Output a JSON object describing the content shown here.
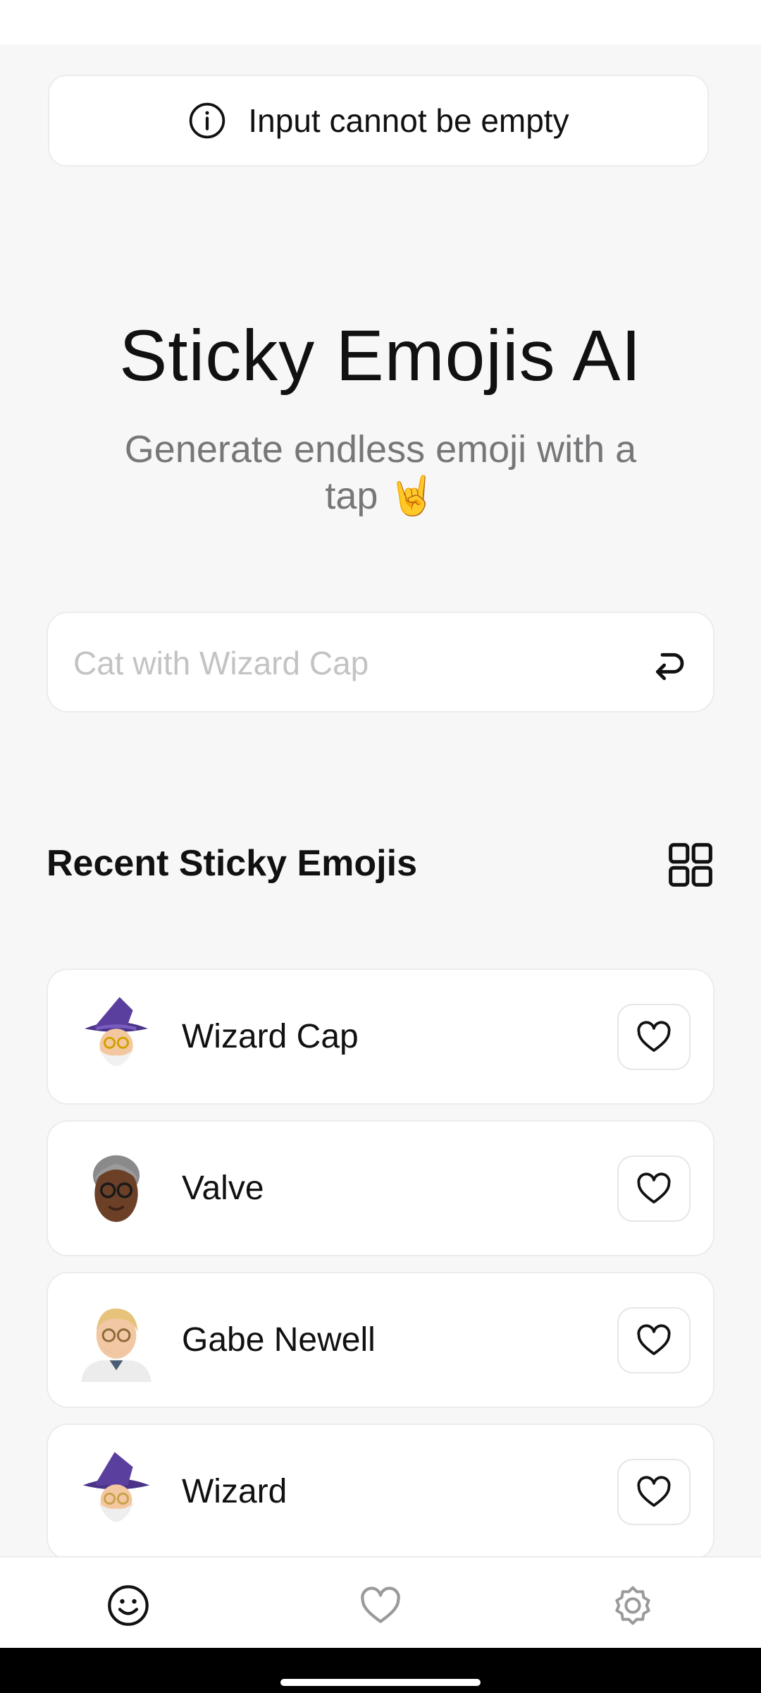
{
  "toast": {
    "message": "Input cannot be empty",
    "icon": "info-icon"
  },
  "header": {
    "title": "Sticky Emojis AI",
    "subtitle": "Generate endless emoji with a tap 🤘"
  },
  "prompt": {
    "placeholder": "Cat with Wizard Cap",
    "value": "",
    "submit_icon": "enter-icon"
  },
  "recent": {
    "title": "Recent Sticky Emojis",
    "view_toggle_icon": "grid-view-icon",
    "items": [
      {
        "label": "Wizard Cap",
        "avatar": "wizard-old-man-emoji",
        "favorited": false
      },
      {
        "label": "Valve",
        "avatar": "man-with-glasses-emoji",
        "favorited": false
      },
      {
        "label": "Gabe Newell",
        "avatar": "blond-man-with-glasses-emoji",
        "favorited": false
      },
      {
        "label": "Wizard",
        "avatar": "wizard-emoji",
        "favorited": false
      }
    ]
  },
  "bottom_nav": {
    "items": [
      {
        "name": "home",
        "icon": "smiley-icon",
        "active": true
      },
      {
        "name": "favorites",
        "icon": "heart-icon",
        "active": false
      },
      {
        "name": "settings",
        "icon": "gear-icon",
        "active": false
      }
    ]
  },
  "colors": {
    "background": "#f7f7f8",
    "card": "#ffffff",
    "border": "#ececee",
    "text": "#111111",
    "muted": "#777779",
    "placeholder": "#c3c3c5",
    "nav_inactive": "#9a9a9c",
    "hat_purple": "#5b3f9e"
  }
}
